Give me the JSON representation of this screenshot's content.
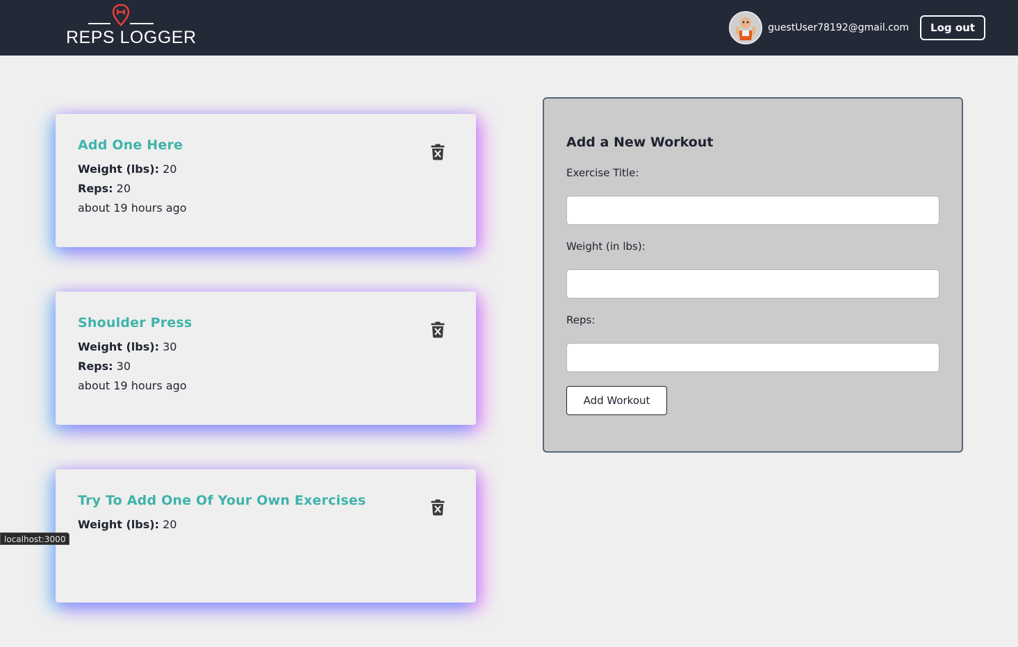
{
  "header": {
    "logo_text": "REPS LOGGER",
    "user_email": "guestUser78192@gmail.com",
    "logout_label": "Log out"
  },
  "workouts": [
    {
      "title": "Add One Here",
      "weight_label": "Weight (lbs):",
      "weight": "20",
      "reps_label": "Reps:",
      "reps": "20",
      "time": "about 19 hours ago"
    },
    {
      "title": "Shoulder Press",
      "weight_label": "Weight (lbs):",
      "weight": "30",
      "reps_label": "Reps:",
      "reps": "30",
      "time": "about 19 hours ago"
    },
    {
      "title": "Try To Add One Of Your Own Exercises",
      "weight_label": "Weight (lbs):",
      "weight": "20",
      "reps_label": "Reps:",
      "reps": "",
      "time": ""
    }
  ],
  "form": {
    "title": "Add a New Workout",
    "title_label": "Exercise Title:",
    "title_value": "",
    "weight_label": "Weight (in lbs):",
    "weight_value": "",
    "reps_label": "Reps:",
    "reps_value": "",
    "submit_label": "Add Workout"
  },
  "status_bar": {
    "url": "localhost:3000"
  },
  "colors": {
    "navbar": "#232937",
    "accent_title": "#3fb3ab",
    "logo_pin": "#e8403a",
    "form_background": "#cbcbcb"
  },
  "icons": [
    "dumbbell-pin-icon",
    "trash-icon",
    "avatar"
  ]
}
